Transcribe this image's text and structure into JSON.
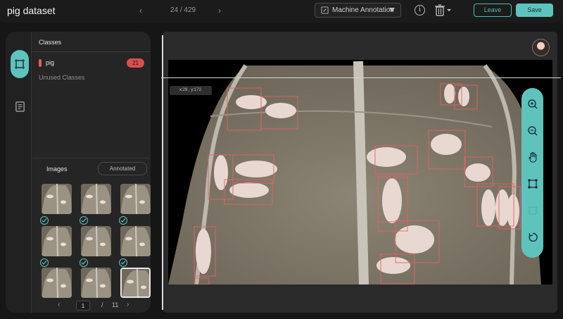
{
  "app": {
    "title": "pig dataset"
  },
  "nav": {
    "counter": "24 / 429",
    "prev_icon": "chevron-left-icon",
    "next_icon": "chevron-right-icon"
  },
  "mode": {
    "label": "Machine Annotation"
  },
  "actions": {
    "leave": "Leave",
    "save": "Save",
    "info_icon": "info-icon",
    "trash_icon": "trash-icon"
  },
  "left_panel": {
    "classes_title": "Classes",
    "classes": [
      {
        "name": "pig",
        "count": "21",
        "color": "#e45d5d"
      }
    ],
    "unused_label": "Unused Classes",
    "images_title": "Images",
    "annotated_button": "Annotated",
    "thumbnails": [
      {
        "annotated": true
      },
      {
        "annotated": true
      },
      {
        "annotated": true
      },
      {
        "annotated": true
      },
      {
        "annotated": true
      },
      {
        "annotated": true
      },
      {
        "annotated": false
      },
      {
        "annotated": false
      },
      {
        "annotated": false,
        "selected": true
      }
    ],
    "pagination": {
      "current": "1",
      "separator": "/",
      "total": "11"
    }
  },
  "canvas": {
    "coordinate_readout": "x:29 , y:172"
  },
  "tools": [
    "zoom-in-icon",
    "zoom-out-icon",
    "hand-icon",
    "bounding-box-icon",
    "blank-tool-icon",
    "reset-icon"
  ],
  "colors": {
    "accent": "#5ec3bd",
    "class_pig": "#e45d5d",
    "background": "#161616"
  }
}
